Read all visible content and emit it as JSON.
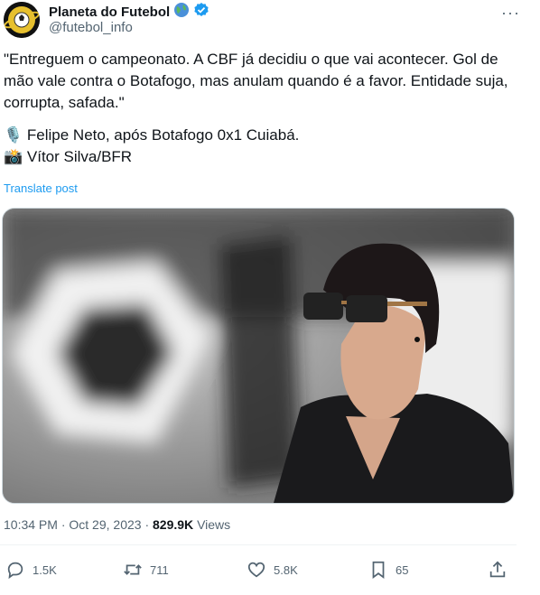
{
  "account": {
    "name": "Planeta do Futebol",
    "handle": "@futebol_info",
    "globe_icon": "globe-emoji",
    "verified_icon": "verified-badge",
    "verified_color": "#1d9bf0"
  },
  "post": {
    "line1": "\"Entreguem o campeonato. A CBF já decidiu o que vai acontecer. Gol de mão vale contra o Botafogo, mas anulam quando é a favor. Entidade suja, corrupta, safada.\"",
    "line2": "🎙️ Felipe Neto, após Botafogo 0x1 Cuiabá.",
    "line3": "📸 Vítor Silva/BFR",
    "translate_label": "Translate post"
  },
  "meta": {
    "time": "10:34 PM",
    "separator": "·",
    "date": "Oct 29, 2023",
    "views_count": "829.9K",
    "views_label": "Views"
  },
  "actions": {
    "replies": "1.5K",
    "reposts": "711",
    "likes": "5.8K",
    "bookmarks": "65"
  },
  "colors": {
    "accent": "#1d9bf0",
    "muted": "#536471",
    "text": "#0f1419"
  }
}
